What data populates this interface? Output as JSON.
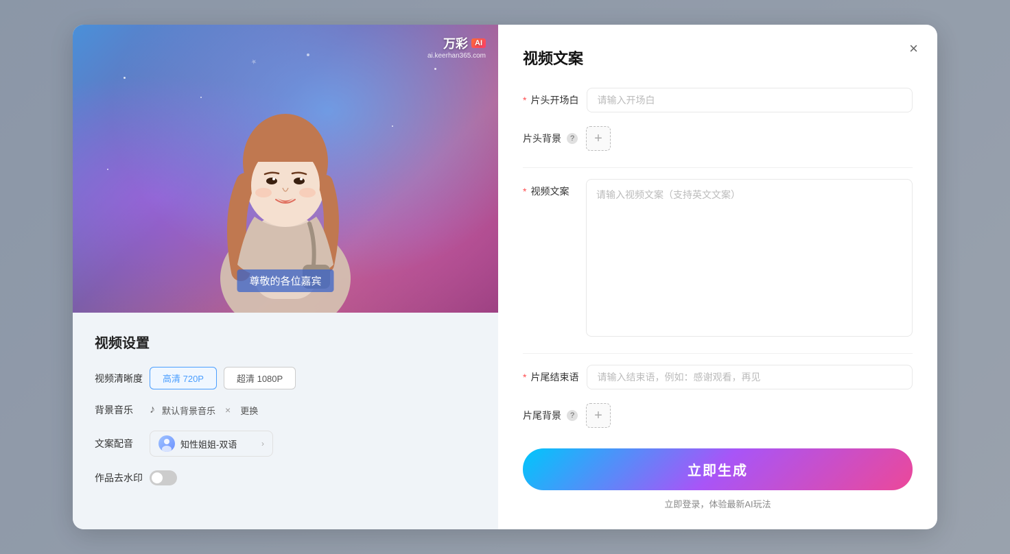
{
  "modal": {
    "close_label": "×"
  },
  "left": {
    "watermark_brand": "万彩",
    "watermark_ai": "AI",
    "watermark_url": "ai.keerhan365.com",
    "subtitle": "尊敬的各位嘉宾",
    "settings_title": "视频设置",
    "quality_label": "视频清晰度",
    "quality_options": [
      {
        "label": "高清 720P",
        "active": true
      },
      {
        "label": "超清 1080P",
        "active": false
      }
    ],
    "music_label": "背景音乐",
    "music_name": "默认背景音乐",
    "music_remove": "×",
    "music_change": "更换",
    "voice_label": "文案配音",
    "voice_name": "知性姐姐-双语",
    "watermark_label": "作品去水印"
  },
  "right": {
    "title": "视频文案",
    "opening_label": "片头开场白",
    "opening_required": "*",
    "opening_placeholder": "请输入开场白",
    "bg_label": "片头背景",
    "bg_add": "+",
    "copy_label": "视频文案",
    "copy_required": "*",
    "copy_placeholder": "请输入视频文案（支持英文文案）",
    "closing_label": "片尾结束语",
    "closing_required": "*",
    "closing_placeholder": "请输入结束语，例如：感谢观看，再见",
    "closing_bg_label": "片尾背景",
    "closing_bg_add": "+",
    "generate_label": "立即生成",
    "login_hint": "立即登录，体验最新AI玩法"
  }
}
